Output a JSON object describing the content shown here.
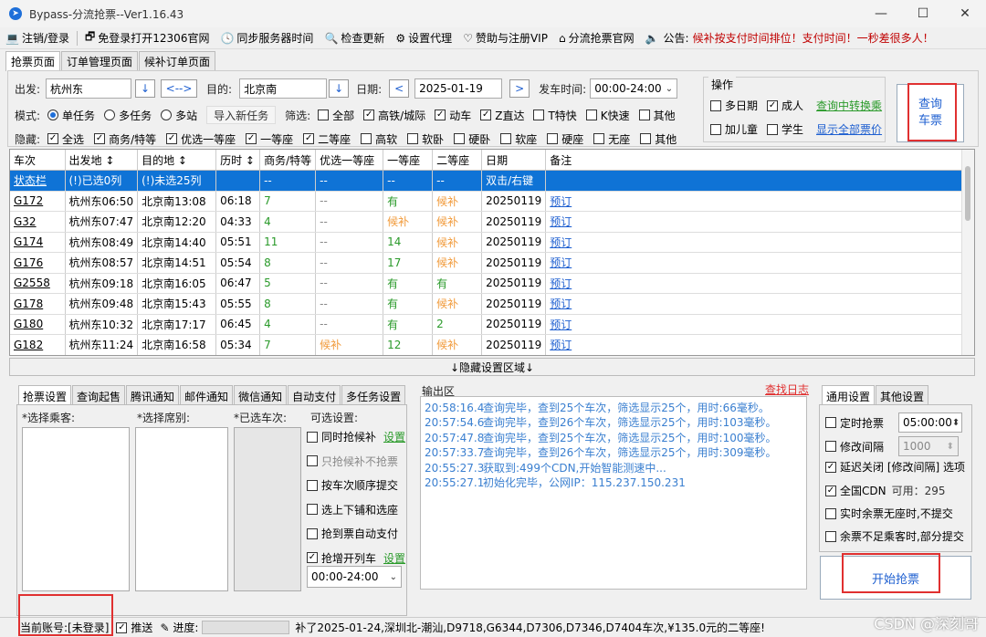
{
  "window": {
    "title": "Bypass-分流抢票--Ver1.16.43",
    "minimize": "—",
    "maximize": "☐",
    "close": "✕"
  },
  "menu": {
    "items": [
      {
        "icon": "💻",
        "label": "注销/登录"
      },
      {
        "icon": "🗗",
        "label": "免登录打开12306官网"
      },
      {
        "icon": "🕓",
        "label": "同步服务器时间"
      },
      {
        "icon": "🔍",
        "label": "检查更新"
      },
      {
        "icon": "⚙",
        "label": "设置代理"
      },
      {
        "icon": "♡",
        "label": "赞助与注册VIP"
      },
      {
        "icon": "⌂",
        "label": "分流抢票官网"
      }
    ],
    "notice_label": "公告:",
    "notice_text": "候补按支付时间排位！支付时间！一秒差很多人！"
  },
  "page_tabs": [
    "抢票页面",
    "订单管理页面",
    "候补订单页面"
  ],
  "search": {
    "from_label": "出发:",
    "from_value": "杭州东",
    "swap_label": "<-->",
    "to_label": "目的:",
    "to_value": "北京南",
    "date_label": "日期:",
    "date_value": "2025-01-19",
    "prev": "<",
    "next": ">",
    "time_label": "发车时间:",
    "time_value": "00:00-24:00",
    "arrow_down": "↓"
  },
  "mode": {
    "label": "模式:",
    "options": [
      {
        "label": "单任务",
        "on": true
      },
      {
        "label": "多任务",
        "on": false
      },
      {
        "label": "多站",
        "on": false
      }
    ],
    "import_btn": "导入新任务",
    "filter_label": "筛选:",
    "filters": [
      {
        "label": "全部",
        "on": false
      },
      {
        "label": "高铁/城际",
        "on": true
      },
      {
        "label": "动车",
        "on": true
      },
      {
        "label": "Z直达",
        "on": true
      },
      {
        "label": "T特快",
        "on": false
      },
      {
        "label": "K快速",
        "on": false
      },
      {
        "label": "其他",
        "on": false
      }
    ]
  },
  "hide": {
    "label": "隐藏:",
    "items": [
      {
        "label": "全选",
        "on": true
      },
      {
        "label": "商务/特等",
        "on": true
      },
      {
        "label": "优选一等座",
        "on": true
      },
      {
        "label": "一等座",
        "on": true
      },
      {
        "label": "二等座",
        "on": true
      },
      {
        "label": "高软",
        "on": false
      },
      {
        "label": "软卧",
        "on": false
      },
      {
        "label": "硬卧",
        "on": false
      },
      {
        "label": "软座",
        "on": false
      },
      {
        "label": "硬座",
        "on": false
      },
      {
        "label": "无座",
        "on": false
      },
      {
        "label": "其他",
        "on": false
      }
    ]
  },
  "ops": {
    "title": "操作",
    "multi_date": "多日期",
    "adult": "成人",
    "transfer_link": "查询中转换乘",
    "child": "加儿童",
    "student": "学生",
    "all_fares_link": "显示全部票价",
    "query_btn_1": "查询",
    "query_btn_2": "车票"
  },
  "table": {
    "headers": [
      "车次",
      "出发地 ↕",
      "目的地 ↕",
      "历时 ↕",
      "商务/特等",
      "优选一等座",
      "一等座",
      "二等座",
      "日期",
      "备注"
    ],
    "status_row": [
      "状态栏",
      "(!)已选0列",
      "(!)未选25列",
      "",
      "--",
      "--",
      "--",
      "--",
      "双击/右键",
      "  "
    ],
    "rows": [
      [
        "G172",
        "杭州东06:50",
        "北京南13:08",
        "06:18",
        "7",
        "--",
        "有",
        "候补",
        "20250119",
        "预订"
      ],
      [
        "G32",
        "杭州东07:47",
        "北京南12:20",
        "04:33",
        "4",
        "--",
        "候补",
        "候补",
        "20250119",
        "预订"
      ],
      [
        "G174",
        "杭州东08:49",
        "北京南14:40",
        "05:51",
        "11",
        "--",
        "14",
        "候补",
        "20250119",
        "预订"
      ],
      [
        "G176",
        "杭州东08:57",
        "北京南14:51",
        "05:54",
        "8",
        "--",
        "17",
        "候补",
        "20250119",
        "预订"
      ],
      [
        "G2558",
        "杭州东09:18",
        "北京南16:05",
        "06:47",
        "5",
        "--",
        "有",
        "有",
        "20250119",
        "预订"
      ],
      [
        "G178",
        "杭州东09:48",
        "北京南15:43",
        "05:55",
        "8",
        "--",
        "有",
        "候补",
        "20250119",
        "预订"
      ],
      [
        "G180",
        "杭州东10:32",
        "北京南17:17",
        "06:45",
        "4",
        "--",
        "有",
        "2",
        "20250119",
        "预订"
      ],
      [
        "G182",
        "杭州东11:24",
        "北京南16:58",
        "05:34",
        "7",
        "候补",
        "12",
        "候补",
        "20250119",
        "预订"
      ]
    ]
  },
  "hide_bar": "↓隐藏设置区域↓",
  "left_tabs": [
    "抢票设置",
    "查询起售",
    "腾讯通知",
    "邮件通知",
    "微信通知",
    "自动支付",
    "多任务设置"
  ],
  "settings": {
    "passenger_label": "*选择乘客:",
    "seat_label": "*选择席别:",
    "train_label": "*已选车次:",
    "optional_label": "可选设置:",
    "options": [
      {
        "label": "同时抢候补",
        "on": false
      },
      {
        "label": "只抢候补不抢票",
        "on": false
      },
      {
        "label": "按车次顺序提交",
        "on": false
      },
      {
        "label": "选上下铺和选座",
        "on": false
      },
      {
        "label": "抢到票自动支付",
        "on": false
      },
      {
        "label": "抢增开列车",
        "on": true
      }
    ],
    "settings_link": "设置",
    "time_value": "00:00-24:00"
  },
  "log": {
    "title": "输出区",
    "view_log": "查找日志",
    "lines": [
      {
        "t": "20:58:16.4",
        "m": "查询完毕，查到25个车次，筛选显示25个，用时:66毫秒。"
      },
      {
        "t": "20:57:54.6",
        "m": "查询完毕，查到26个车次，筛选显示25个，用时:103毫秒。"
      },
      {
        "t": "20:57:47.8",
        "m": "查询完毕，查到25个车次，筛选显示25个，用时:100毫秒。"
      },
      {
        "t": "20:57:33.7",
        "m": "查询完毕，查到26个车次，筛选显示25个，用时:309毫秒。"
      },
      {
        "t": "20:55:27.3",
        "m": "获取到:499个CDN,开始智能测速中..."
      },
      {
        "t": "20:55:27.1",
        "m": "初始化完毕，公网IP：115.237.150.231"
      }
    ]
  },
  "right_tabs": [
    "通用设置",
    "其他设置"
  ],
  "general": {
    "timed": "定时抢票",
    "timed_value": "05:00:00",
    "interval": "修改间隔",
    "interval_value": "1000",
    "delay_close": "延迟关闭 [修改间隔] 选项",
    "cdn": "全国CDN",
    "cdn_avail": "可用：295",
    "realtime": "实时余票无座时,不提交",
    "partial": "余票不足乘客时,部分提交",
    "start_btn": "开始抢票"
  },
  "status": {
    "account": "当前账号:[未登录]",
    "push": "推送",
    "progress_label": "进度:",
    "scroll_text": "补了2025-01-24,深圳北-潮汕,D9718,G6344,D7306,D7346,D7404车次,¥135.0元的二等座!"
  },
  "watermark": "CSDN @深刻哥"
}
